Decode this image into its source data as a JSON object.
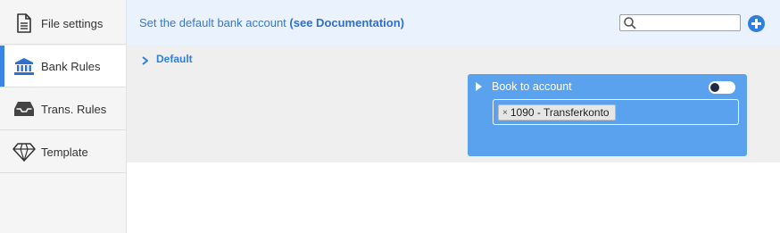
{
  "sidebar": {
    "items": [
      {
        "label": "File settings",
        "icon": "file-icon",
        "active": false
      },
      {
        "label": "Bank Rules",
        "icon": "bank-icon",
        "active": true
      },
      {
        "label": "Trans. Rules",
        "icon": "inbox-icon",
        "active": false
      },
      {
        "label": "Template",
        "icon": "diamond-icon",
        "active": false
      }
    ]
  },
  "header": {
    "text": "Set the default bank account",
    "doc_link": "(see Documentation)",
    "search_placeholder": "",
    "add_icon": "plus-circle-icon"
  },
  "main": {
    "default_label": "Default",
    "card": {
      "title": "Book to account",
      "toggle_on": false,
      "tag_remove": "×",
      "tag_value": "1090 - Transferkonto"
    }
  },
  "colors": {
    "accent": "#3a84e8",
    "header_bg": "#eaf2fd",
    "card_bg": "#5aa2ee"
  }
}
